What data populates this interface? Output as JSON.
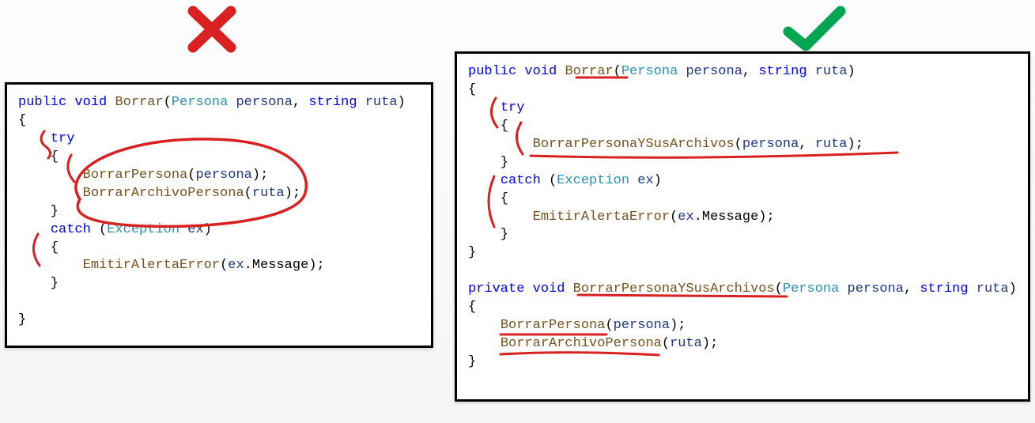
{
  "icons": {
    "wrong": "cross-icon",
    "right": "check-icon"
  },
  "colors": {
    "wrong": "#d92121",
    "right": "#00a651",
    "annotation": "#d92121",
    "keyword": "#0000ff",
    "type": "#2b91af",
    "method": "#74531f",
    "param": "#1f377f"
  },
  "left_code": {
    "line1_public": "public",
    "line1_void": "void",
    "line1_method": "Borrar",
    "line1_p_open": "(",
    "line1_type1": "Persona",
    "line1_param1": "persona",
    "line1_comma": ", ",
    "line1_type2": "string",
    "line1_param2": "ruta",
    "line1_p_close": ")",
    "line2": "{",
    "line3_try": "try",
    "line4": "    {",
    "line5_call": "BorrarPersona",
    "line5_open": "(",
    "line5_arg": "persona",
    "line5_close": ");",
    "line6_call": "BorrarArchivoPersona",
    "line6_open": "(",
    "line6_arg": "ruta",
    "line6_close": ");",
    "line7": "    }",
    "line8_catch": "catch",
    "line8_open": " (",
    "line8_type": "Exception",
    "line8_param": " ex",
    "line8_close": ")",
    "line9": "    {",
    "line10_call": "EmitirAlertaError",
    "line10_open": "(",
    "line10_arg": "ex",
    "line10_dot": ".Message);",
    "line11": "    }",
    "line12": "}"
  },
  "right_code": {
    "sig1_public": "public",
    "sig1_void": "void",
    "sig1_method": "Borrar",
    "sig1_p_open": "(",
    "sig1_type1": "Persona",
    "sig1_param1": "persona",
    "sig1_comma": ", ",
    "sig1_type2": "string",
    "sig1_param2": "ruta",
    "sig1_p_close": ")",
    "b_open1": "{",
    "try_kw": "try",
    "try_open": "    {",
    "call1_m": "BorrarPersonaYSusArchivos",
    "call1_o": "(",
    "call1_a1": "persona",
    "call1_c": ", ",
    "call1_a2": "ruta",
    "call1_cl": ");",
    "try_close": "    }",
    "catch_kw": "catch",
    "catch_o": " (",
    "catch_t": "Exception",
    "catch_p": " ex",
    "catch_c": ")",
    "catch_open": "    {",
    "call2_m": "EmitirAlertaError",
    "call2_o": "(",
    "call2_a": "ex",
    "call2_d": ".Message);",
    "catch_close": "    }",
    "b_close1": "}",
    "sig2_private": "private",
    "sig2_void": "void",
    "sig2_method": "BorrarPersonaYSusArchivos",
    "sig2_p_open": "(",
    "sig2_type1": "Persona",
    "sig2_param1": "persona",
    "sig2_comma": ", ",
    "sig2_type2": "string",
    "sig2_param2": "ruta",
    "sig2_p_close": ")",
    "b_open2": "{",
    "call3_m": "BorrarPersona",
    "call3_o": "(",
    "call3_a": "persona",
    "call3_c": ");",
    "call4_m": "BorrarArchivoPersona",
    "call4_o": "(",
    "call4_a": "ruta",
    "call4_c": ");",
    "b_close2": "}"
  }
}
